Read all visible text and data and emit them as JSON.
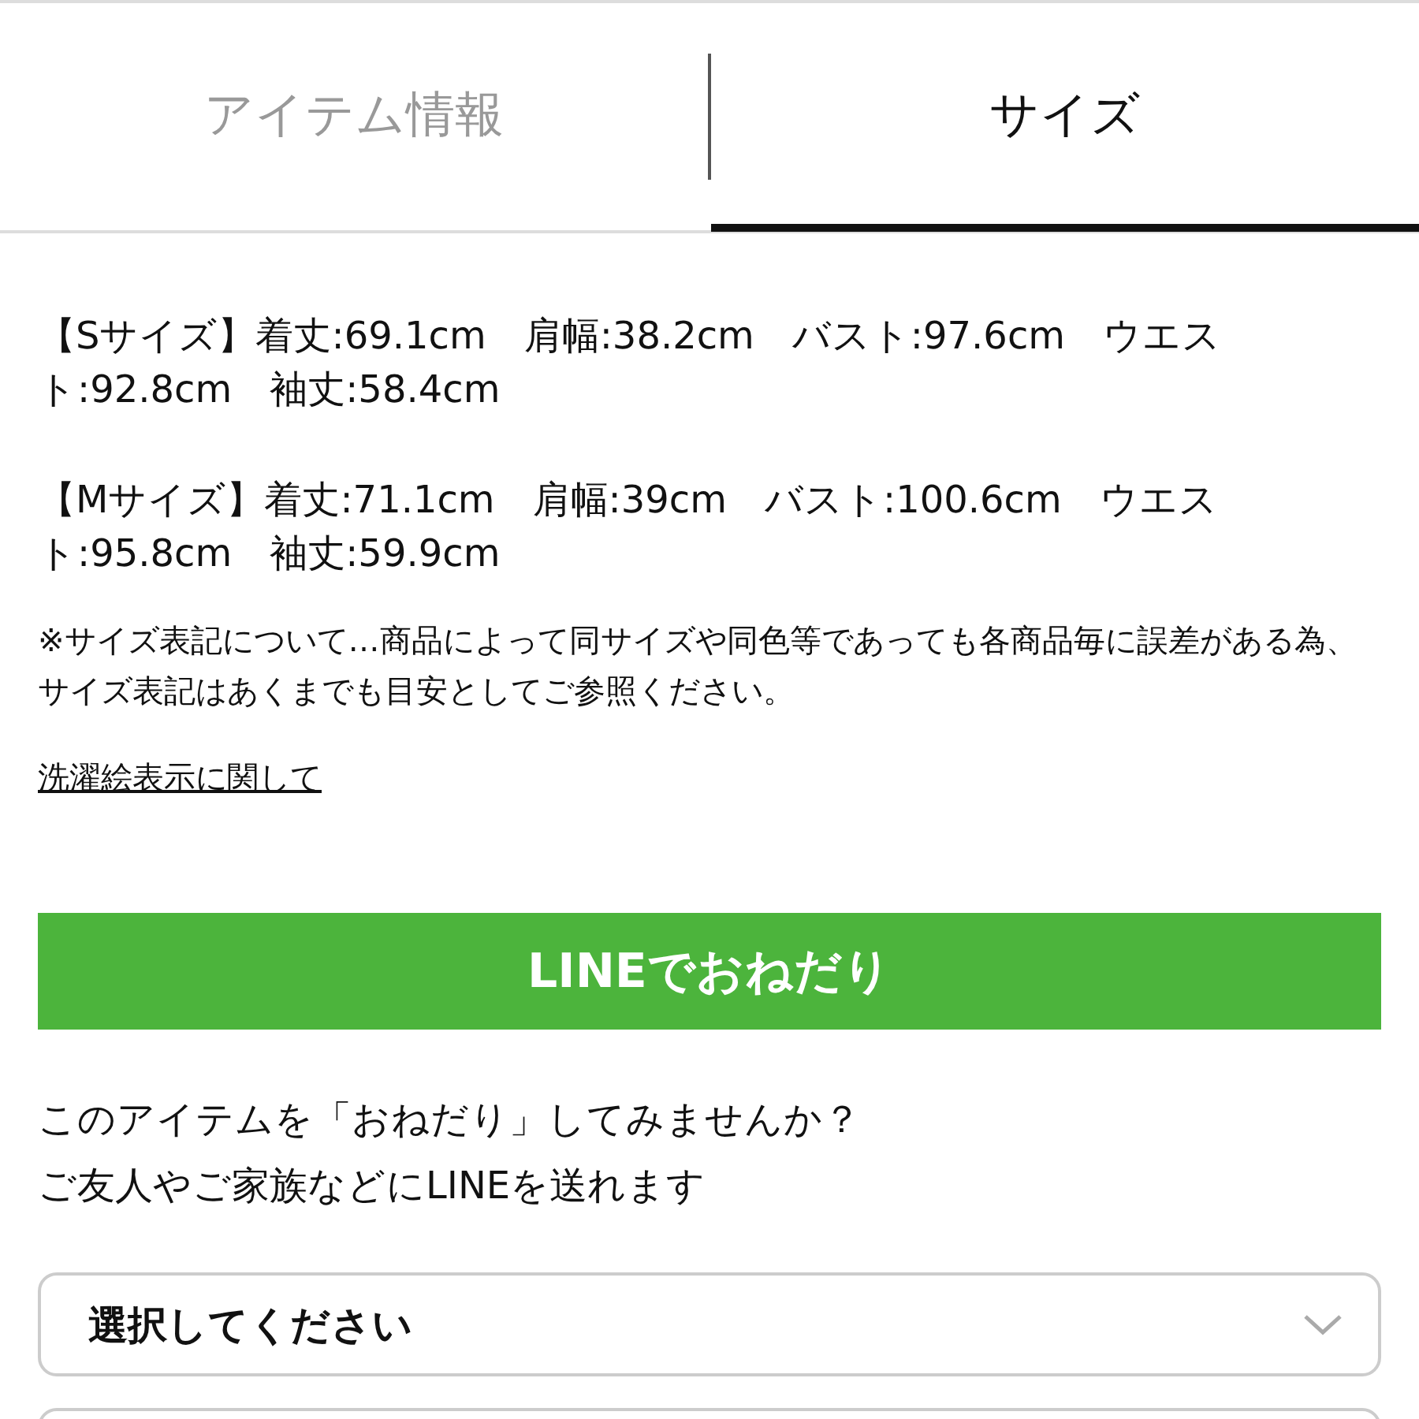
{
  "tabs": [
    {
      "label": "アイテム情報",
      "selected": false
    },
    {
      "label": "サイズ",
      "selected": true
    }
  ],
  "sizes": [
    "【Sサイズ】着丈:69.1cm　肩幅:38.2cm　バスト:97.6cm　ウエスト:92.8cm　袖丈:58.4cm",
    "【Mサイズ】着丈:71.1cm　肩幅:39cm　バスト:100.6cm　ウエスト:95.8cm　袖丈:59.9cm"
  ],
  "note": "※サイズ表記について…商品によって同サイズや同色等であっても各商品毎に誤差がある為、サイズ表記はあくまでも目安としてご参照ください。",
  "care_link": "洗濯絵表示に関して",
  "line_button": "LINEでおねだり",
  "intro": [
    "このアイテムを「おねだり」してみませんか？",
    "ご友人やご家族などにLINEを送れます"
  ],
  "select": {
    "placeholder": "選択してください"
  }
}
